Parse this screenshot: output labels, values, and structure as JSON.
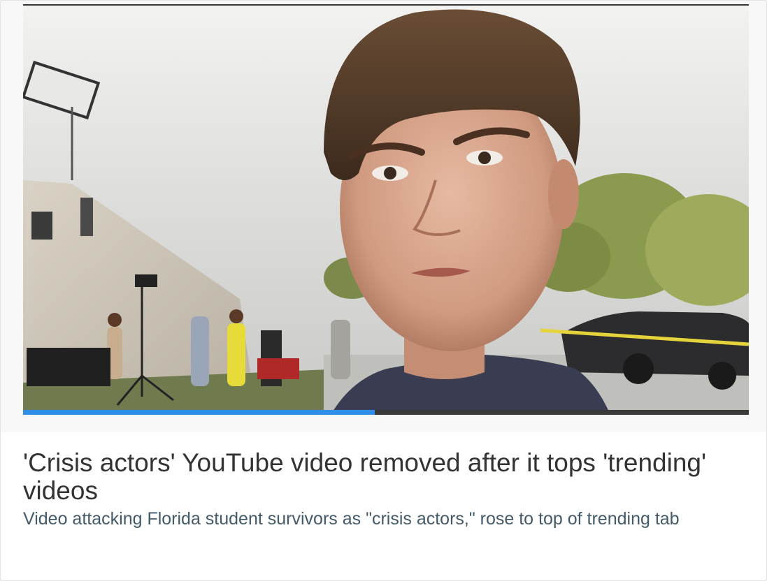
{
  "article": {
    "headline": "'Crisis actors' YouTube video removed after it tops 'trending' videos",
    "subheadline": "Video attacking Florida student survivors as \"crisis actors,\" rose to top of trending tab"
  },
  "video": {
    "progress_fraction": 0.485,
    "progress_color": "#2f8fe8"
  },
  "colors": {
    "headline": "#333333",
    "subheadline": "#435a6a",
    "card_background": "#ffffff"
  }
}
